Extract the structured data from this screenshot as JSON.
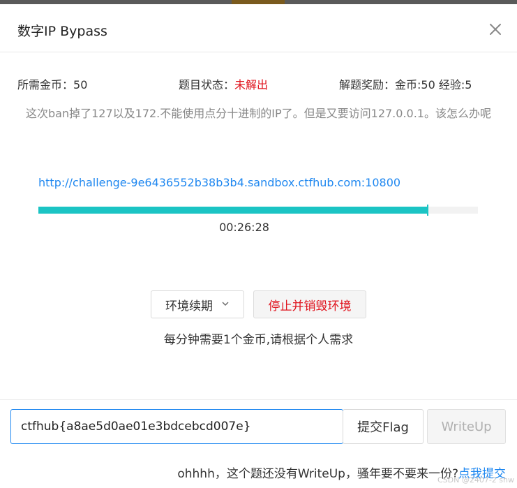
{
  "modal": {
    "title": "数字IP Bypass"
  },
  "info": {
    "coins_label": "所需金币：",
    "coins_value": "50",
    "status_label": "题目状态：",
    "status_value": "未解出",
    "reward_label": "解题奖励：",
    "reward_value": "金币:50 经验:5"
  },
  "description": "这次ban掉了127以及172.不能使用点分十进制的IP了。但是又要访问127.0.0.1。该怎么办呢",
  "environment": {
    "url": "http://challenge-9e6436552b38b3b4.sandbox.ctfhub.com:10800",
    "time_remaining": "00:26:28",
    "progress_fraction": 0.886
  },
  "actions": {
    "renew_label": "环境续期",
    "destroy_label": "停止并销毁环境",
    "cost_note": "每分钟需要1个金币,请根据个人需求"
  },
  "flag_form": {
    "input_value": "ctfhub{a8ae5d0ae01e3bdcebcd007e}",
    "submit_label": "提交Flag",
    "writeup_label": "WriteUp"
  },
  "writeup_note": {
    "text": "ohhhh，这个题还没有WriteUp，骚年要不要来一份?",
    "link": "点我提交"
  },
  "watermark": "CSDN @2407-2 shw",
  "colors": {
    "accent": "#1e87f0",
    "danger": "#e0141e",
    "progress": "#1bc4c4"
  },
  "icons": {
    "close": "close-icon",
    "renew_dropdown": "chevron-down-icon"
  }
}
